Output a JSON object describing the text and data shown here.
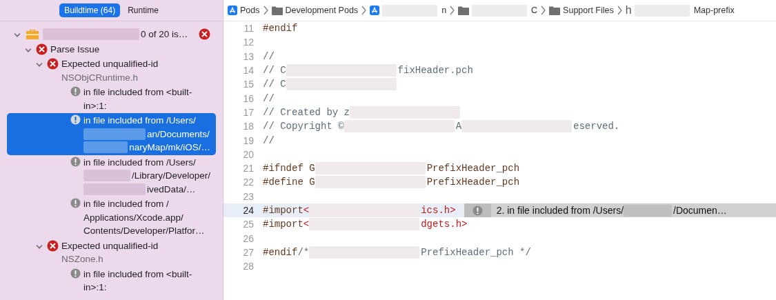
{
  "navigator": {
    "tabs": [
      {
        "label": "Buildtime (64)",
        "selected": true
      },
      {
        "label": "Runtime",
        "selected": false
      }
    ],
    "issues": [
      {
        "kind": "target",
        "lines": [
          {
            "text": "0 of 20 is…",
            "redacted": true
          }
        ],
        "expanded": true,
        "selected": false,
        "children": [
          {
            "kind": "error",
            "lines": [
              {
                "text": "Parse Issue"
              }
            ],
            "expanded": true,
            "selected": false,
            "children": [
              {
                "kind": "error",
                "lines": [
                  {
                    "text": "Expected unqualified-id"
                  }
                ],
                "file": "NSObjCRuntime.h",
                "expanded": true,
                "selected": false,
                "children": [
                  {
                    "kind": "note",
                    "lines": [
                      {
                        "text": "in file included from <built-"
                      },
                      {
                        "text": "in>:1:"
                      }
                    ],
                    "selected": false
                  },
                  {
                    "kind": "note",
                    "lines": [
                      {
                        "text": "in file included from /Users/"
                      },
                      {
                        "text": "an/Documents/",
                        "redacted": true
                      },
                      {
                        "text": "naryMap/mk/iOS/…",
                        "redacted": true
                      }
                    ],
                    "selected": true
                  },
                  {
                    "kind": "note",
                    "lines": [
                      {
                        "text": "in file included from /Users/"
                      },
                      {
                        "text": "/Library/Developer/",
                        "redacted": true
                      },
                      {
                        "text": "ivedData/…",
                        "redacted": true
                      }
                    ],
                    "selected": false
                  },
                  {
                    "kind": "note",
                    "lines": [
                      {
                        "text": "in file included from /"
                      },
                      {
                        "text": "Applications/Xcode.app/"
                      },
                      {
                        "text": "Contents/Developer/Platfor…"
                      }
                    ],
                    "selected": false
                  }
                ]
              },
              {
                "kind": "error",
                "lines": [
                  {
                    "text": "Expected unqualified-id"
                  }
                ],
                "file": "NSZone.h",
                "expanded": true,
                "selected": false,
                "children": [
                  {
                    "kind": "note",
                    "lines": [
                      {
                        "text": "in file included from <built-"
                      },
                      {
                        "text": "in>:1:"
                      }
                    ],
                    "selected": false
                  }
                ]
              }
            ]
          }
        ]
      }
    ]
  },
  "breadcrumb": [
    {
      "label": "Pods",
      "kind": "app",
      "redacted": false
    },
    {
      "label": "Development Pods",
      "kind": "folder",
      "redacted": false
    },
    {
      "label": "n",
      "kind": "app",
      "redacted": true
    },
    {
      "label": "C",
      "kind": "folder",
      "redacted": true
    },
    {
      "label": "Support Files",
      "kind": "folder",
      "redacted": false
    },
    {
      "label": "Map-prefix",
      "kind": "header",
      "glyph": "h",
      "redacted": true
    }
  ],
  "editor": {
    "lines": [
      {
        "number": "11",
        "highlighted": false,
        "segments": [
          {
            "kind": "directive",
            "text": "#endif"
          }
        ]
      },
      {
        "number": "12",
        "highlighted": false
      },
      {
        "number": "13",
        "highlighted": false,
        "segments": [
          {
            "kind": "comment",
            "text": "//"
          }
        ]
      },
      {
        "number": "14",
        "highlighted": false,
        "segments": [
          {
            "kind": "comment",
            "text": "//  C"
          },
          {
            "kind": "redaction"
          },
          {
            "kind": "comment",
            "text": "fixHeader.pch"
          }
        ]
      },
      {
        "number": "15",
        "highlighted": false,
        "segments": [
          {
            "kind": "comment",
            "text": "//  C"
          },
          {
            "kind": "redaction"
          }
        ]
      },
      {
        "number": "16",
        "highlighted": false,
        "segments": [
          {
            "kind": "comment",
            "text": "//"
          }
        ]
      },
      {
        "number": "17",
        "highlighted": false,
        "segments": [
          {
            "kind": "comment",
            "text": "//  Created by z"
          },
          {
            "kind": "redaction"
          }
        ]
      },
      {
        "number": "18",
        "highlighted": false,
        "segments": [
          {
            "kind": "comment",
            "text": "//  Copyright © "
          },
          {
            "kind": "redaction"
          },
          {
            "kind": "comment",
            "text": "A"
          },
          {
            "kind": "redaction"
          },
          {
            "kind": "comment",
            "text": "eserved."
          }
        ]
      },
      {
        "number": "19",
        "highlighted": false,
        "segments": [
          {
            "kind": "comment",
            "text": "//"
          }
        ]
      },
      {
        "number": "20",
        "highlighted": false
      },
      {
        "number": "21",
        "highlighted": false,
        "segments": [
          {
            "kind": "directive",
            "text": "#ifndef G"
          },
          {
            "kind": "redaction"
          },
          {
            "kind": "directive",
            "text": "PrefixHeader_pch"
          }
        ]
      },
      {
        "number": "22",
        "highlighted": false,
        "segments": [
          {
            "kind": "directive",
            "text": "#define G"
          },
          {
            "kind": "redaction"
          },
          {
            "kind": "directive",
            "text": "PrefixHeader_pch"
          }
        ]
      },
      {
        "number": "23",
        "highlighted": false
      },
      {
        "number": "24",
        "highlighted": true,
        "segments": [
          {
            "kind": "directive",
            "text": "#import "
          },
          {
            "kind": "string",
            "text": "<"
          },
          {
            "kind": "redaction"
          },
          {
            "kind": "string",
            "text": "ics.h>"
          }
        ],
        "annotation": {
          "text": "2. in file included from /Users/",
          "redacted_tail": "/Documen…"
        }
      },
      {
        "number": "25",
        "highlighted": false,
        "segments": [
          {
            "kind": "directive",
            "text": "#import "
          },
          {
            "kind": "string",
            "text": "<"
          },
          {
            "kind": "redaction"
          },
          {
            "kind": "string",
            "text": "dgets.h>"
          }
        ]
      },
      {
        "number": "26",
        "highlighted": false
      },
      {
        "number": "27",
        "highlighted": false,
        "segments": [
          {
            "kind": "directive",
            "text": "#endif "
          },
          {
            "kind": "comment",
            "text": "/*"
          },
          {
            "kind": "redaction"
          },
          {
            "kind": "comment",
            "text": "PrefixHeader_pch */"
          }
        ]
      },
      {
        "number": "28",
        "highlighted": false
      }
    ]
  }
}
